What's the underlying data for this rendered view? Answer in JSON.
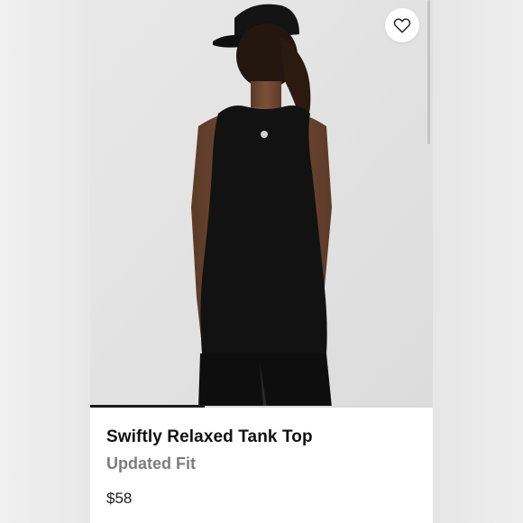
{
  "product": {
    "name": "Swiftly Relaxed Tank Top",
    "subtitle": "Updated Fit",
    "price": "$58"
  },
  "icons": {
    "favorite": "heart-outline-icon"
  },
  "gallery": {
    "active_slide": 1
  },
  "colors": {
    "accent": "#1a1a1a",
    "subtitle": "#7d7d7d",
    "background": "#ececec"
  }
}
